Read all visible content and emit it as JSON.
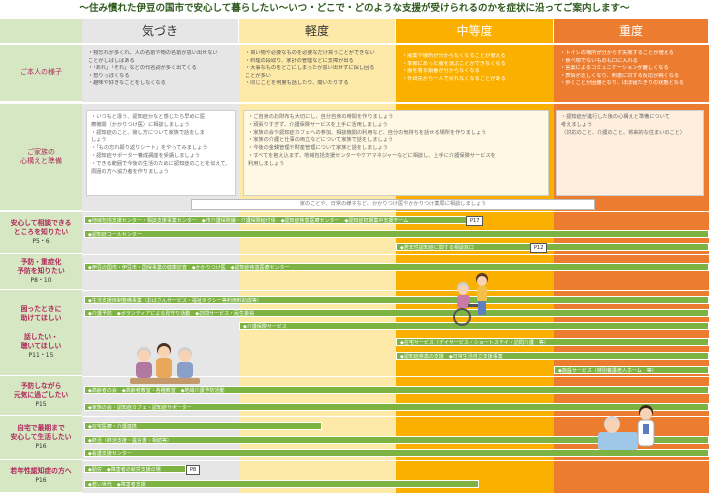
{
  "title": "〜住み慣れた伊豆の国市で安心して暮らしたい〜いつ・どこで・どのような支援が受けられるのかを症状に沿ってご案内します〜",
  "columns": [
    "気づき",
    "軽度",
    "中等度",
    "重度"
  ],
  "row_labels": {
    "person": "ご本人の様子",
    "family": "ご家族の\n心構えと準備",
    "consult": "安心して相談できる\nところを知りたい",
    "consult_pg": "P5・6",
    "prevent": "予防・重症化\n予防を知りたい",
    "prevent_pg": "P8・10",
    "help": "困ったときに\n助けてほしい",
    "talk": "話したい・\n聴いてほしい",
    "help_pg": "P11・15",
    "live": "予防しながら\n元気に過ごしたい",
    "live_pg": "P15",
    "home": "自宅で最期まで\n安心して生活したい",
    "home_pg": "P16",
    "young": "若年性認知症の方へ",
    "young_pg": "P16"
  },
  "person": {
    "awareness": [
      "・物忘れが多くれ、人の名前や物の名前が思い出せない",
      "ことがしばしばある",
      "・「あれ」「それ」などの代名詞が多く出てくる",
      "・怒りっぽくなる",
      "・趣味や好きなことをしなくなる"
    ],
    "mild": [
      "・買い物や必要なものを必要なだけ買うことができない",
      "・料理の段取り、家計の管理などに支障が出る",
      "・大事なものをどこにしまったか思い出せずに探し回る",
      "ことが多い",
      "・同じことを何度も話したり、聞いたりする"
    ],
    "moderate": [
      "・服薬や場所が分からなくなることが増える",
      "・季節にあった服を選ぶことができなくなる",
      "・服を着る順番が分からなくなる",
      "・外出先から一人で戻れなくなることがある"
    ],
    "severe": [
      "・トイレの場所が分からず失敗することが増える",
      "・食べ物でないものも口に入れる",
      "・言葉によるコミュニケーションが難しくなる",
      "・表情が乏しくなり、刺激に対する反応が鈍くなる",
      "・歩くことが困難となり、ほぼ寝たきりの状態となる"
    ]
  },
  "family": {
    "awareness": [
      "・いつもと違う、認知症かなと感じたら早めに医",
      "療機関（かかりつけ医）に相談しましょう",
      "・認知症のこと、接し方について家族で話をしま",
      "しょう",
      "・「もの忘れ振り返りシート」をやってみましょう",
      "・認知症サポーター養成講座を受講しましょう",
      "・できる範囲で今後の生活のために認知症のことを伝えて、",
      "周囲の方へ協力者を作りましょう"
    ],
    "mild": [
      "・ご自身のお財布も大切にし、自分自身の時間を作りましょう",
      "・頑張りすぎず、介護保険サービスを上手に活用しましょう",
      "・家族の会や認知症カフェへの参加、相談機関の利用など、自分の気持ちを話せる場所を作りましょう",
      "・家族の介護と仕事の両立などについて家族で話をしましょう",
      "・今後の金銭管理や財産管理について家族と話をしましょう",
      "・すべてを抱え込まず、地域包括支援センターやケアマネジャーなどに相談し、上手に介護保険サービスを",
      "利用しましょう"
    ],
    "severe": [
      "・認知症が進行した後の心構えと準備について",
      "考えましょう",
      "（対応のこと、介護のこと、将来的な住まいのこと）"
    ]
  },
  "note": "家のことや、日常の様子など、かかりつけ医やかかりつけ薬局に相談しましょう",
  "bars": {
    "consult1": "◆地域包括支援センター・相談支援事業センター　◆市介護保険課・介護保険給付係　◆認知症疾患医療センター　◆認知症初期集中支援チーム",
    "consult2": "◆認知症コールセンター",
    "consult3": "◆若年性認知症に関する相談窓口",
    "prevent1": "◆伊豆の国市・伊豆市・国保事業の健康診査　◆かかりつけ医　◆認知症疾患医療センター",
    "help1": "◆生活支援体制整備事業（おばさんサービス・福祉タクシー等利用料助成等）",
    "help2": "◆介護予防　◆ボランティアによる見守り活動　◆訪問サービス・民生委員",
    "help3": "◆介護保険サービス",
    "help4": "◆在宅サービス（デイサービス・ショートステイ・訪問介護　等）",
    "help5": "◆認知症疾患の支援　◆日常生活自立支援事業",
    "help6": "◆施設サービス（特別養護老人ホーム　等）",
    "live1": "◆高齢者の会　◆高齢者教室・各種教室　◆地域介護予防活動",
    "live2": "◆家族の会・認知症カフェ・認知症サポーター",
    "home1": "◆在宅医療・介護連携",
    "home2": "◆終活（終活支援・遺言書・相続等）",
    "home3": "◆看護支援センター",
    "young1": "◆勤労　◆障害者の就労支援の場",
    "young2": "◆若い世代　◆障害者支援"
  },
  "pg_tags": {
    "t1": "P17",
    "t2": "P12",
    "t3": "P8"
  },
  "colors": {
    "awareness": "#e6e6e6",
    "mild": "#fde9a8",
    "moderate": "#fbb000",
    "severe": "#ec7c30",
    "label": "#d5e8c3",
    "bar": "#7cb342"
  }
}
